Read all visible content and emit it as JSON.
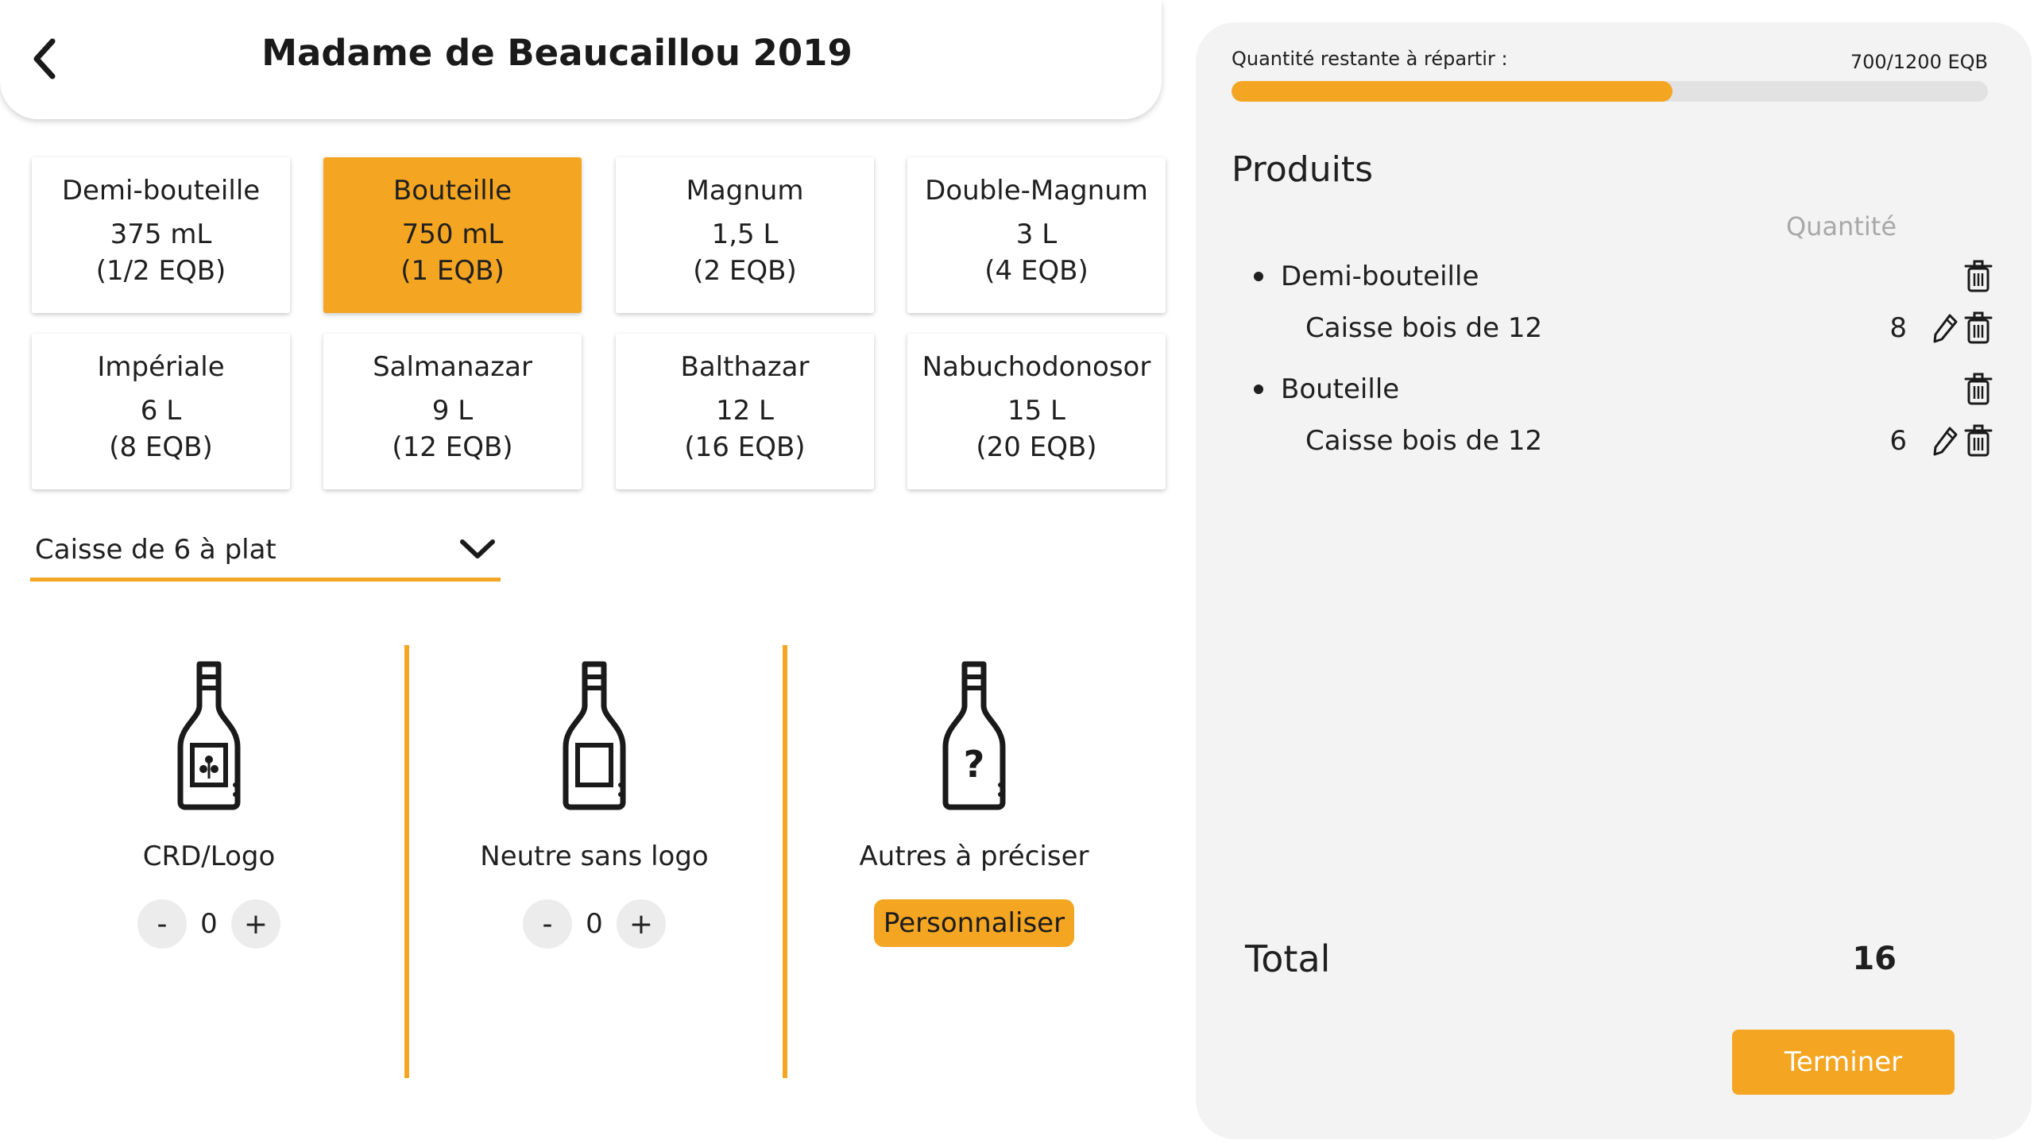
{
  "header": {
    "title": "Madame de Beaucaillou 2019"
  },
  "formats": [
    {
      "name": "Demi-bouteille",
      "volume": "375 mL",
      "eqb": "(1/2 EQB)",
      "selected": false
    },
    {
      "name": "Bouteille",
      "volume": "750 mL",
      "eqb": "(1 EQB)",
      "selected": true
    },
    {
      "name": "Magnum",
      "volume": "1,5 L",
      "eqb": "(2 EQB)",
      "selected": false
    },
    {
      "name": "Double-Magnum",
      "volume": "3 L",
      "eqb": "(4 EQB)",
      "selected": false
    },
    {
      "name": "Impériale",
      "volume": "6 L",
      "eqb": "(8 EQB)",
      "selected": false
    },
    {
      "name": "Salmanazar",
      "volume": "9 L",
      "eqb": "(12 EQB)",
      "selected": false
    },
    {
      "name": "Balthazar",
      "volume": "12 L",
      "eqb": "(16 EQB)",
      "selected": false
    },
    {
      "name": "Nabuchodonosor",
      "volume": "15 L",
      "eqb": "(20 EQB)",
      "selected": false
    }
  ],
  "packaging_select": {
    "value": "Caisse de 6 à plat"
  },
  "options": [
    {
      "label": "CRD/Logo",
      "quantity": "0",
      "icon": "bottle-crd-logo-icon"
    },
    {
      "label": "Neutre sans logo",
      "quantity": "0",
      "icon": "bottle-neutral-icon"
    },
    {
      "label": "Autres à préciser",
      "button_label": "Personnaliser",
      "icon": "bottle-question-icon"
    }
  ],
  "stepper_labels": {
    "minus": "-",
    "plus": "+"
  },
  "panel": {
    "remaining_label": "Quantité restante à répartir :",
    "remaining_value": "700/1200 EQB",
    "remaining_progress": 0.5833,
    "products_title": "Produits",
    "quantity_header": "Quantité",
    "products": [
      {
        "category": "Demi-bouteille",
        "items": [
          {
            "label": "Caisse bois de 12",
            "quantity": "8"
          }
        ]
      },
      {
        "category": "Bouteille",
        "items": [
          {
            "label": "Caisse bois de 12",
            "quantity": "6"
          }
        ]
      }
    ],
    "total_label": "Total",
    "total_value": "16",
    "finish_label": "Terminer"
  },
  "colors": {
    "accent": "#f4a522",
    "panel_bg": "#f3f3f3",
    "muted_text": "#a8a8a8"
  }
}
